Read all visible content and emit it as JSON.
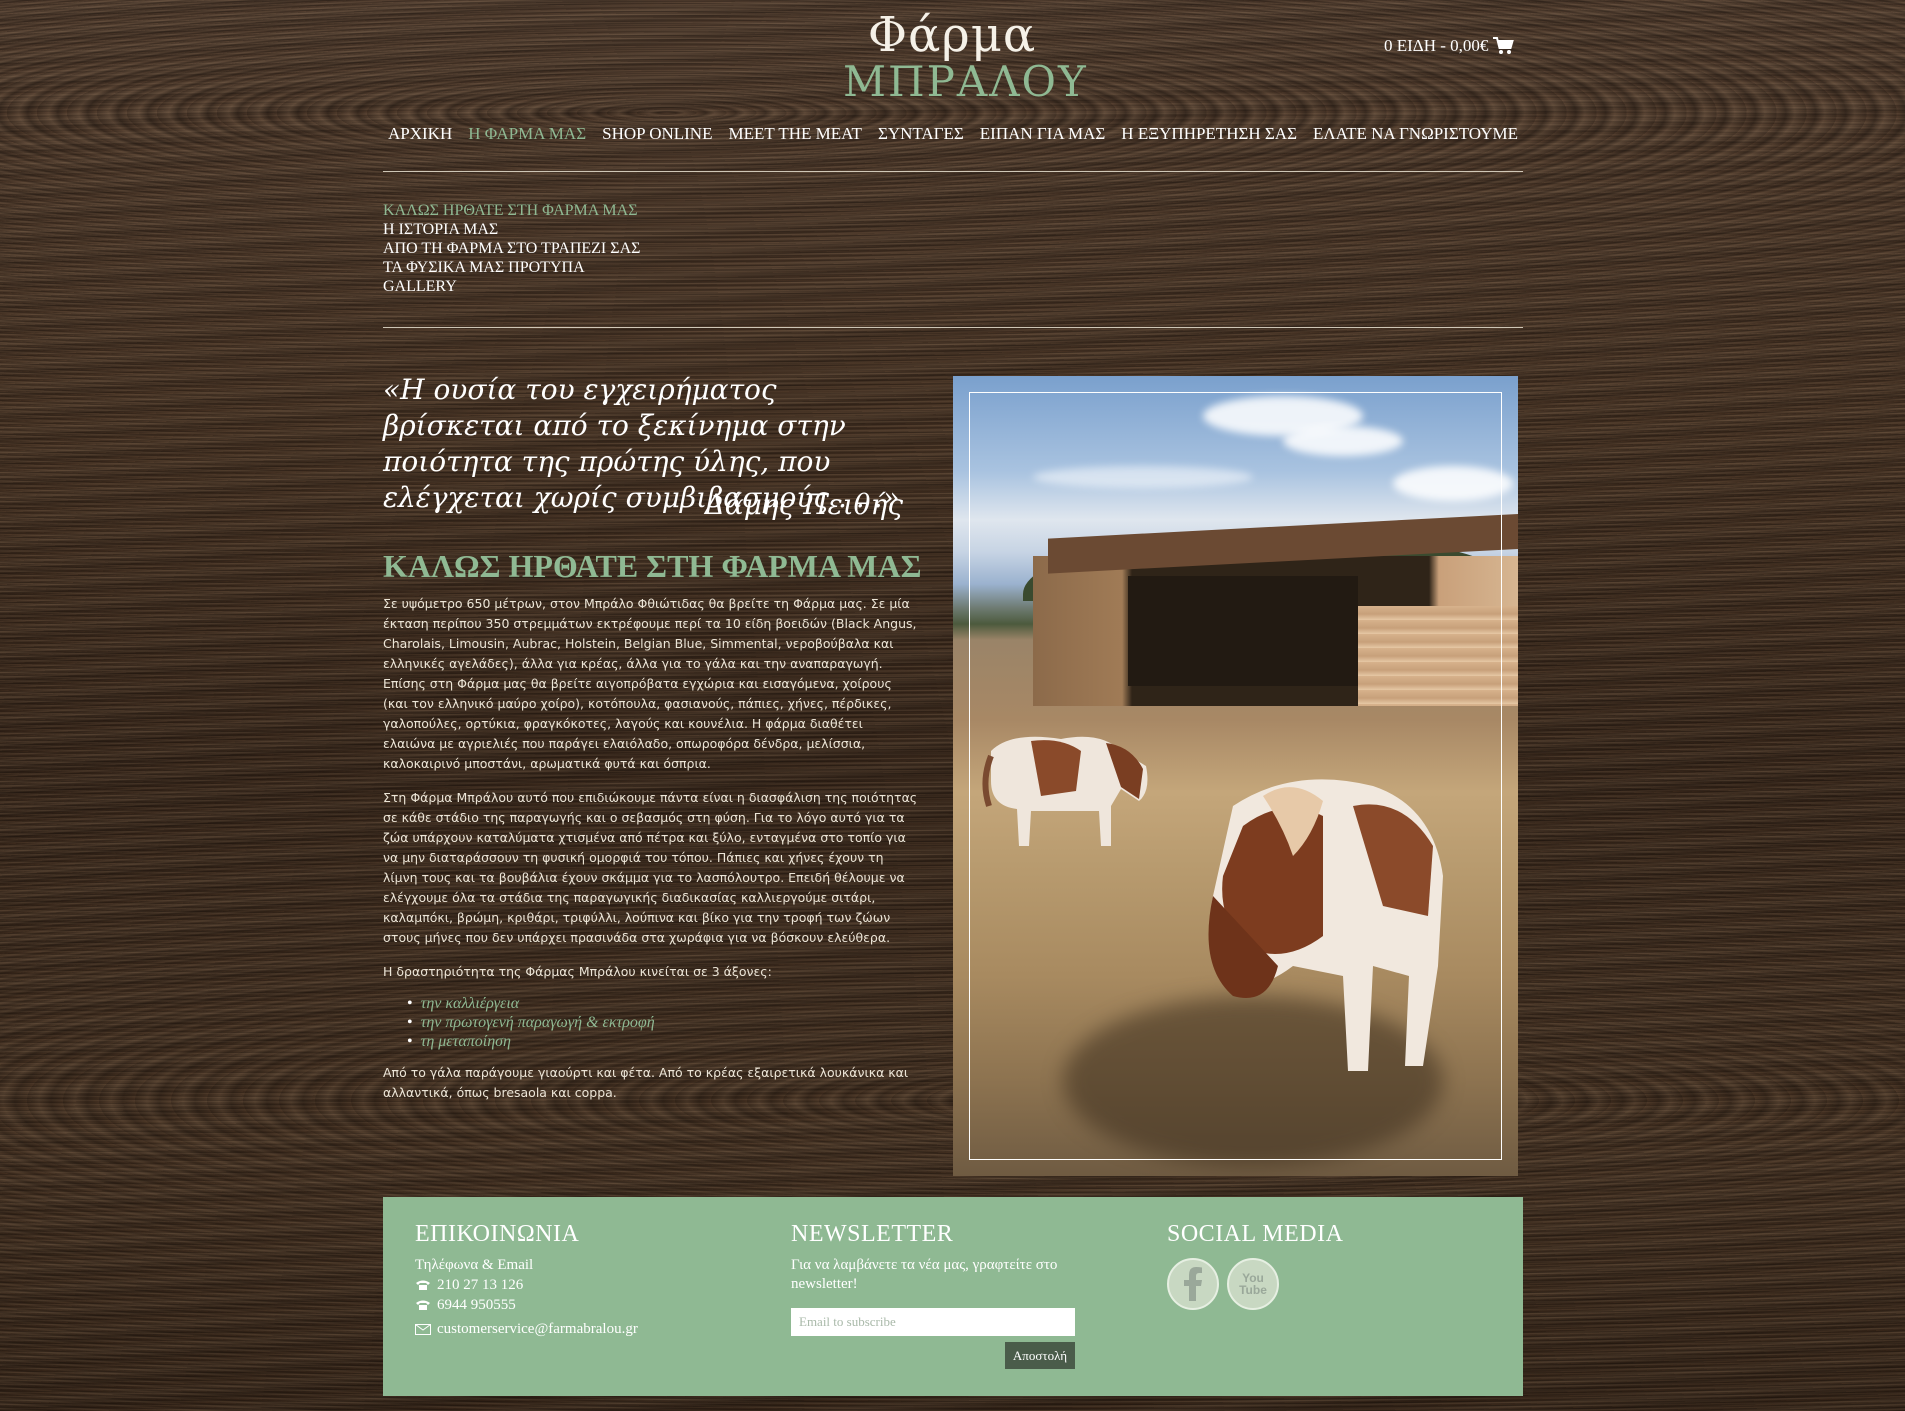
{
  "header": {
    "logo_line1": "Φάρμα",
    "logo_line2": "ΜΠΡΑΛΟΥ",
    "cart_text": "0 ΕΙΔΗ - 0,00€"
  },
  "mainnav": [
    {
      "label": "ΑΡΧΙΚΗ",
      "active": false
    },
    {
      "label": "Η ΦΑΡΜΑ ΜΑΣ",
      "active": true
    },
    {
      "label": "SHOP ONLINE",
      "active": false
    },
    {
      "label": "MEET THE MEAT",
      "active": false
    },
    {
      "label": "ΣΥΝΤΑΓΕΣ",
      "active": false
    },
    {
      "label": "ΕΙΠΑΝ ΓΙΑ ΜΑΣ",
      "active": false
    },
    {
      "label": "Η ΕΞΥΠΗΡΕΤΗΣΗ ΣΑΣ",
      "active": false
    },
    {
      "label": "ΕΛΑΤΕ ΝΑ ΓΝΩΡΙΣΤΟΥΜΕ",
      "active": false
    }
  ],
  "subnav": [
    {
      "label": "ΚΑΛΩΣ ΗΡΘΑΤΕ ΣΤΗ ΦΑΡΜΑ ΜΑΣ",
      "active": true
    },
    {
      "label": "Η ΙΣΤΟΡΙΑ ΜΑΣ",
      "active": false
    },
    {
      "label": "ΑΠΟ ΤΗ ΦΑΡΜΑ ΣΤΟ ΤΡΑΠΕΖΙ ΣΑΣ",
      "active": false
    },
    {
      "label": "ΤΑ ΦΥΣΙΚΑ ΜΑΣ ΠΡΟΤΥΠΑ",
      "active": false
    },
    {
      "label": "GALLERY",
      "active": false
    }
  ],
  "content": {
    "quote": "«Η ουσία του εγχειρήματος βρίσκεται από το ξεκίνημα στην ποιότητα της πρώτης ύλης, που ελέγχεται χωρίς συμβιβασμούς . . .»",
    "quote_author": "Δάμης Πειθής",
    "heading": "ΚΑΛΩΣ ΗΡΘΑΤΕ ΣΤΗ ΦΑΡΜΑ ΜΑΣ",
    "p1": "Σε υψόμετρο 650 μέτρων, στον Μπράλο Φθιώτιδας θα βρείτε τη Φάρμα μας. Σε μία έκταση περίπου 350 στρεμμάτων εκτρέφουμε περί τα 10 είδη βοειδών (Black Angus, Charolais, Limousin, Aubrac, Holstein, Belgian Blue, Simmental, νεροβούβαλα και ελληνικές αγελάδες), άλλα για κρέας, άλλα για το γάλα και την αναπαραγωγή. Επίσης στη Φάρμα μας θα βρείτε αιγοπρόβατα εγχώρια και εισαγόμενα, χοίρους (και τον ελληνικό μαύρο χοίρο), κοτόπουλα, φασιανούς, πάπιες, χήνες, πέρδικες, γαλοπούλες, ορτύκια, φραγκόκοτες, λαγούς και κουνέλια. Η φάρμα διαθέτει ελαιώνα με αγριελιές που παράγει ελαιόλαδο, οπωροφόρα δένδρα, μελίσσια, καλοκαιρινό μποστάνι, αρωματικά φυτά και όσπρια.",
    "p2": "Στη Φάρμα Μπράλου αυτό που επιδιώκουμε πάντα είναι η διασφάλιση της ποιότητας σε κάθε στάδιο της παραγωγής και ο σεβασμός στη φύση. Για το λόγο αυτό για τα ζώα υπάρχουν καταλύματα χτισμένα από πέτρα και ξύλο, ενταγμένα στο τοπίο για να μην διαταράσσουν τη φυσική ομορφιά του τόπου. Πάπιες και χήνες έχουν τη λίμνη τους και τα βουβάλια έχουν σκάμμα για το λασπόλουτρο. Επειδή θέλουμε να ελέγχουμε όλα τα στάδια της παραγωγικής διαδικασίας καλλιεργούμε σιτάρι, καλαμπόκι, βρώμη, κριθάρι, τριφύλλι, λούπινα και βίκο για την τροφή των ζώων στους μήνες που δεν υπάρχει πρασινάδα στα χωράφια για να βόσκουν ελεύθερα.",
    "p3": "Η δραστηριότητα της Φάρμας Μπράλου κινείται σε 3 άξονες:",
    "axes": [
      "την καλλιέργεια",
      "την πρωτογενή παραγωγή & εκτροφή",
      "τη μεταποίηση"
    ],
    "p4": "Από το γάλα παράγουμε γιαούρτι και φέτα. Από το κρέας εξαιρετικά λουκάνικα και αλλαντικά, όπως bresaola και coppa."
  },
  "footer": {
    "contact_title": "ΕΠΙΚΟΙΝΩΝΙΑ",
    "contact_sub": "Τηλέφωνα & Email",
    "phone1": "210 27 13 126",
    "phone2": "6944 950555",
    "email": "customerservice@farmabralou.gr",
    "newsletter_title": "NEWSLETTER",
    "newsletter_text": "Για να λαμβάνετε τα νέα μας, γραφτείτε στο newsletter!",
    "newsletter_placeholder": "Email to subscribe",
    "newsletter_button": "Αποστολή",
    "social_title": "SOCIAL MEDIA",
    "social_youtube_line1": "You",
    "social_youtube_line2": "Tube"
  },
  "colors": {
    "accent_green": "#8fb993",
    "footer_button": "#4a5c4a"
  }
}
